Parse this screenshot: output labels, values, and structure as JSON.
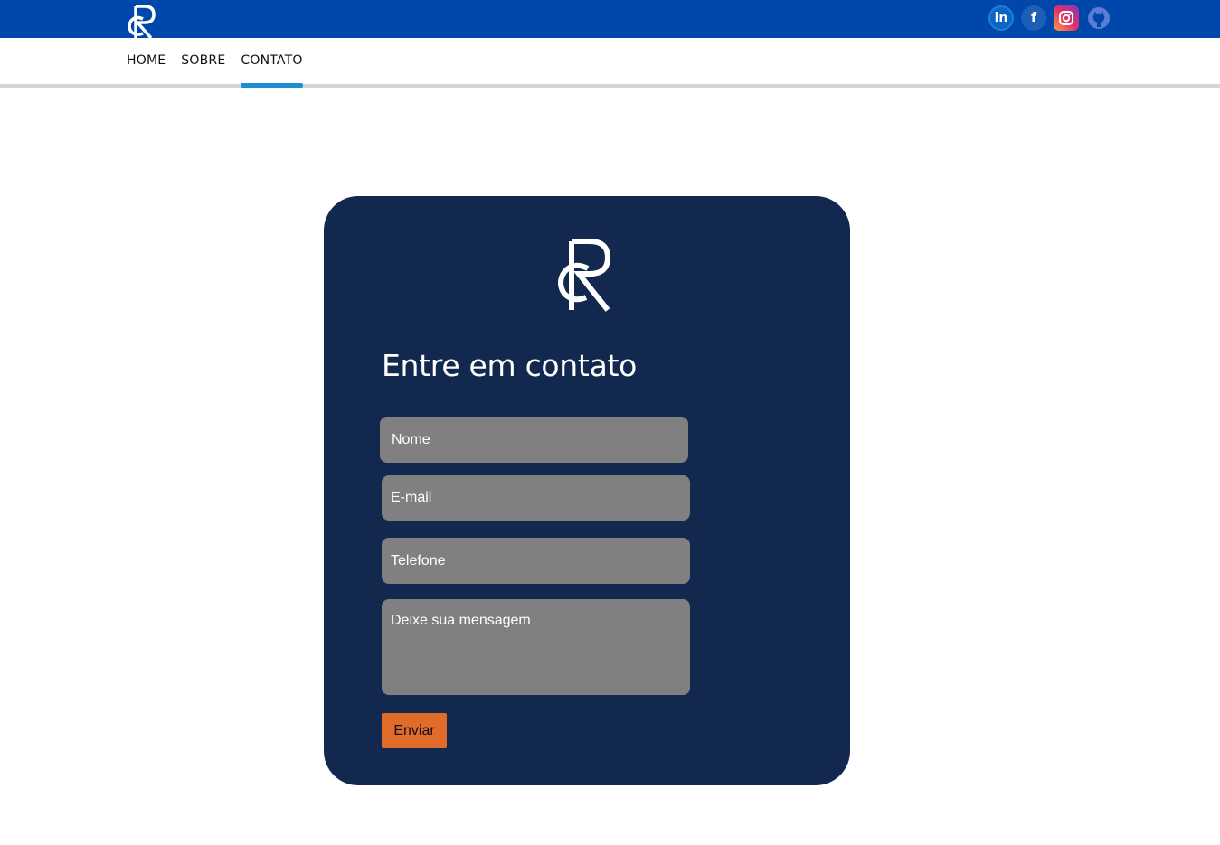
{
  "header": {
    "logo_icon": "rc-monogram-logo",
    "social": [
      {
        "name": "linkedin-icon",
        "glyph": "in"
      },
      {
        "name": "facebook-icon",
        "glyph": "f"
      },
      {
        "name": "instagram-icon",
        "glyph": "instagram"
      },
      {
        "name": "github-icon",
        "glyph": "github"
      }
    ],
    "color": "#0047ab"
  },
  "nav": {
    "items": [
      {
        "label": "HOME"
      },
      {
        "label": "SOBRE"
      },
      {
        "label": "CONTATO"
      }
    ],
    "active": "CONTATO",
    "active_color": "#1a8fd6"
  },
  "contact": {
    "logo_icon": "rc-monogram-logo",
    "title": "Entre em contato",
    "fields": {
      "nome_placeholder": "Nome",
      "email_placeholder": "E-mail",
      "telefone_placeholder": "Telefone",
      "mensagem_placeholder": "Deixe sua mensagem"
    },
    "submit_label": "Enviar",
    "card_color": "#12284e",
    "button_color": "#e06b2a"
  }
}
